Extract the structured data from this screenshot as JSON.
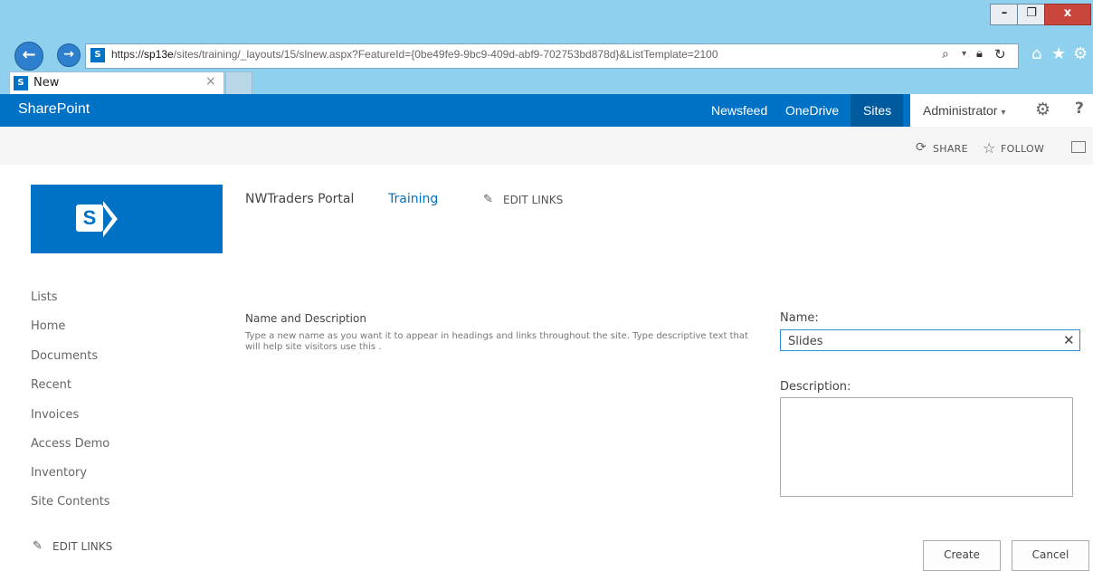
{
  "browser": {
    "url_scheme": "https://",
    "url_host": "sp13e",
    "url_path": "/sites/training/_layouts/15/slnew.aspx?FeatureId={0be49fe9-9bc9-409d-abf9-702753bd878d}&ListTemplate=2100",
    "tab_title": "New",
    "tab_close": "×",
    "minimize": "–",
    "restore": "❐",
    "close": "x"
  },
  "suite": {
    "brand": "SharePoint",
    "links": [
      "Newsfeed",
      "OneDrive",
      "Sites"
    ],
    "user": "Administrator",
    "help": "?"
  },
  "actions": {
    "share": "SHARE",
    "follow": "FOLLOW"
  },
  "logo": {
    "letter": "S"
  },
  "topnav": {
    "portal": "NWTraders Portal",
    "training": "Training",
    "edit_links": "EDIT LINKS"
  },
  "leftnav": {
    "items": [
      "Lists",
      "Home",
      "Documents",
      "Recent",
      "Invoices",
      "Access Demo",
      "Inventory",
      "Site Contents"
    ],
    "edit_links": "EDIT LINKS"
  },
  "form": {
    "section_title": "Name and Description",
    "section_desc": "Type a new name as you want it to appear in headings and links throughout the site. Type descriptive text that will help site visitors use this .",
    "name_label": "Name:",
    "name_value": "Slides",
    "description_label": "Description:",
    "description_value": "",
    "create": "Create",
    "cancel": "Cancel"
  },
  "colors": {
    "accent": "#0072c6",
    "chrome": "#8fd0ee",
    "close_button": "#c9463d"
  }
}
